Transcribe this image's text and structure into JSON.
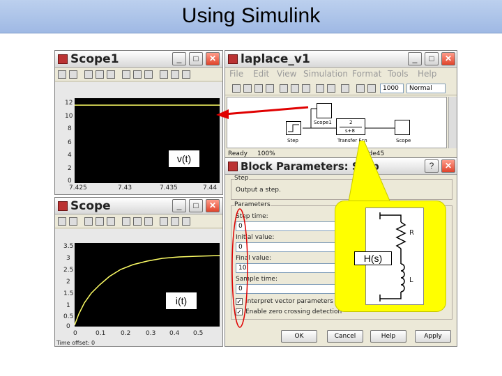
{
  "slide": {
    "title": "Using Simulink"
  },
  "scope1": {
    "title": "Scope1",
    "y_ticks": [
      "12",
      "10",
      "8",
      "6",
      "4",
      "2",
      "0"
    ],
    "x_ticks": [
      "7.425",
      "7.43",
      "7.435",
      "7.44"
    ]
  },
  "scope2": {
    "title": "Scope",
    "y_ticks": [
      "3.5",
      "3",
      "2.5",
      "2",
      "1.5",
      "1",
      "0.5",
      "0"
    ],
    "x_ticks": [
      "0",
      "0.1",
      "0.2",
      "0.3",
      "0.4",
      "0.5"
    ],
    "status": "Time offset: 0"
  },
  "model": {
    "title": "laplace_v1",
    "menu": [
      "File",
      "Edit",
      "View",
      "Simulation",
      "Format",
      "Tools",
      "Help"
    ],
    "stop_time": "1000",
    "sim_mode": "Normal",
    "blocks": {
      "step": "Step",
      "scope1": "Scope1",
      "transfer": "Transfer Fcn",
      "scope": "Scope",
      "num": "2",
      "den": "s+8"
    },
    "status": {
      "ready": "Ready",
      "zoom": "100%",
      "solver": "ode45"
    }
  },
  "dialog": {
    "title": "Block Parameters: Step",
    "section_step": "Step",
    "description": "Output a step.",
    "section_params": "Parameters",
    "step_time_label": "Step time:",
    "step_time_value": "0",
    "initial_label": "Initial value:",
    "initial_value": "0",
    "final_label": "Final value:",
    "final_value": "10",
    "sample_label": "Sample time:",
    "sample_value": "0",
    "check1": "Interpret vector parameters as 1-D",
    "check2": "Enable zero crossing detection",
    "buttons": {
      "ok": "OK",
      "cancel": "Cancel",
      "help": "Help",
      "apply": "Apply"
    }
  },
  "callouts": {
    "vt": "v(t)",
    "it": "i(t)",
    "hs": "H(s)"
  },
  "circuit": {
    "r": "R",
    "l": "L"
  },
  "colors": {
    "arrow": "#e00000",
    "callout_bg": "#ffff00",
    "header": "#a8c0e8"
  }
}
